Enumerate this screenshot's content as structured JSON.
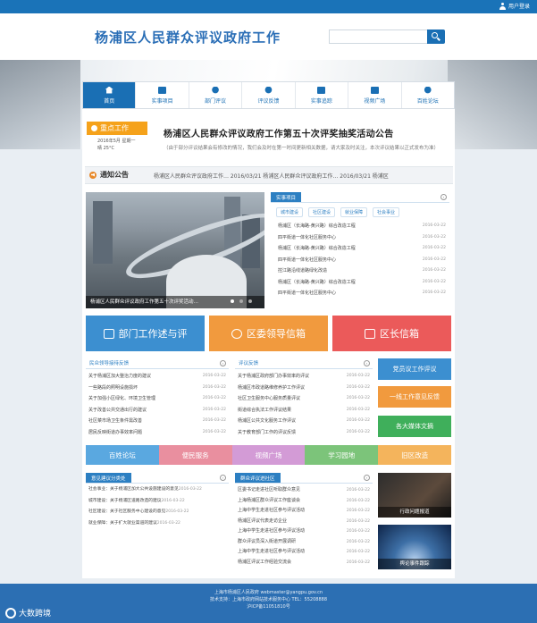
{
  "top_bar": {
    "login_label": "用户登录"
  },
  "header": {
    "site_title": "杨浦区人民群众评议政府工作",
    "search_placeholder": ""
  },
  "nav": {
    "items": [
      "首页",
      "实事项目",
      "部门评议",
      "评议反馈",
      "实事追踪",
      "视频广场",
      "百姓论坛"
    ],
    "active": 0
  },
  "headline": {
    "tag": "重点工作",
    "date": "2016年5月 星期一",
    "weather": "晴 25°C",
    "title": "杨浦区人民群众评议政府工作第五十次评奖抽奖活动公告",
    "summary": "（由于部分评议结果会有修改的情况，我们会及时在第一时间更新相关数据，请大家及时关注，本次评议结果以正式发布为准）"
  },
  "notice": {
    "label": "通知公告",
    "text": "杨浦区人民群众评议政府工作…  2016/03/21    杨浦区人民群众评议政府工作…  2016/03/21    杨浦区"
  },
  "photo": {
    "caption": "杨浦区人民群众评议政府工作第五十次评奖活动…"
  },
  "shishi": {
    "title": "实事项目",
    "tabs": [
      "城市建设",
      "社区建设",
      "就业保障",
      "社会事业"
    ],
    "items": [
      {
        "t": "杨浦区（长海路-黄兴路）综合改造工程",
        "d": "2016-03-22"
      },
      {
        "t": "四平街道一体化社区服务中心",
        "d": "2016-03-22"
      },
      {
        "t": "杨浦区（长海路-黄兴路）综合改造工程",
        "d": "2016-03-22"
      },
      {
        "t": "四平街道一体化社区服务中心",
        "d": "2016-03-22"
      },
      {
        "t": "控江路沿线道路绿化改造",
        "d": "2016-03-22"
      },
      {
        "t": "杨浦区（长海路-黄兴路）综合改造工程",
        "d": "2016-03-22"
      },
      {
        "t": "四平街道一体化社区服务中心",
        "d": "2016-03-22"
      }
    ]
  },
  "big_buttons": [
    "部门工作述与评",
    "区委领导信箱",
    "区长信箱"
  ],
  "duoban": {
    "title": "民众领导接待反馈",
    "items": [
      {
        "t": "关于杨浦区加大整治力度的建议",
        "d": "2016-03-22"
      },
      {
        "t": "一些路段的照明设施损坏",
        "d": "2016-03-22"
      },
      {
        "t": "关于加强小区绿化、环境卫生管理",
        "d": "2016-03-22"
      },
      {
        "t": "关于改善公共交通出行的建议",
        "d": "2016-03-22"
      },
      {
        "t": "社区菜市场卫生条件需改善",
        "d": "2016-03-22"
      },
      {
        "t": "居民反映街道办事效率问题",
        "d": "2016-03-22"
      }
    ]
  },
  "pingyi": {
    "title": "评议反馈",
    "items": [
      {
        "t": "关于杨浦区政府部门办事效率的评议",
        "d": "2016-03-22"
      },
      {
        "t": "杨浦区市政道路维修养护工作评议",
        "d": "2016-03-22"
      },
      {
        "t": "社区卫生服务中心服务质量评议",
        "d": "2016-03-22"
      },
      {
        "t": "街道综合执法工作评议结果",
        "d": "2016-03-22"
      },
      {
        "t": "杨浦区公共文化服务工作评议",
        "d": "2016-03-22"
      },
      {
        "t": "关于教育部门工作的评议反馈",
        "d": "2016-03-22"
      }
    ]
  },
  "side_buttons": [
    "党员议工作评议",
    "一线工作意见反馈",
    "各大媒体文摘"
  ],
  "strip": [
    {
      "label": "百姓论坛",
      "color": "#5aa8e0"
    },
    {
      "label": "便民服务",
      "color": "#e98f9f"
    },
    {
      "label": "视频广场",
      "color": "#d39bd6"
    },
    {
      "label": "学习园地",
      "color": "#7cc47a"
    },
    {
      "label": "旧区改造",
      "color": "#f4b45c"
    }
  ],
  "yijian": {
    "title": "意见建议分类处",
    "items": [
      {
        "t": "社会事业：关于杨浦区加大公共设施建设的意见",
        "d": "2016-03-22"
      },
      {
        "t": "城市建设：关于杨浦区道路改造的建议",
        "d": "2016-03-22"
      },
      {
        "t": "社区建设：关于社区服务中心建设的意见",
        "d": "2016-03-22"
      },
      {
        "t": "就业保障：关于扩大就业渠道的建议",
        "d": "2016-03-22"
      }
    ]
  },
  "pinglun": {
    "title": "群众评议进社区",
    "items": [
      {
        "t": "区委书记走进社区听取群众意见",
        "d": "2016-03-22"
      },
      {
        "t": "上海杨浦区群众评议工作座谈会",
        "d": "2016-03-22"
      },
      {
        "t": "上海中学生走进社区参与评议活动",
        "d": "2016-03-22"
      },
      {
        "t": "杨浦区评议代表走访企业",
        "d": "2016-03-22"
      },
      {
        "t": "上海中学生走进社区参与评议活动",
        "d": "2016-03-22"
      },
      {
        "t": "群众评议员深入街道开展调研",
        "d": "2016-03-22"
      },
      {
        "t": "上海中学生走进社区参与评议活动",
        "d": "2016-03-22"
      },
      {
        "t": "杨浦区评议工作经验交流会",
        "d": "2016-03-22"
      }
    ]
  },
  "thumbs": [
    "行政问题报道",
    "舆论事件跟踪"
  ],
  "footer": {
    "line1": "上海市杨浦区人民政府  webmaster@yangpu.gov.cn",
    "line2": "技术支持：上海市政府网站技术服务中心  TEL：55208888",
    "line3": "沪ICP备11051810号"
  },
  "watermark": "大数跨境"
}
